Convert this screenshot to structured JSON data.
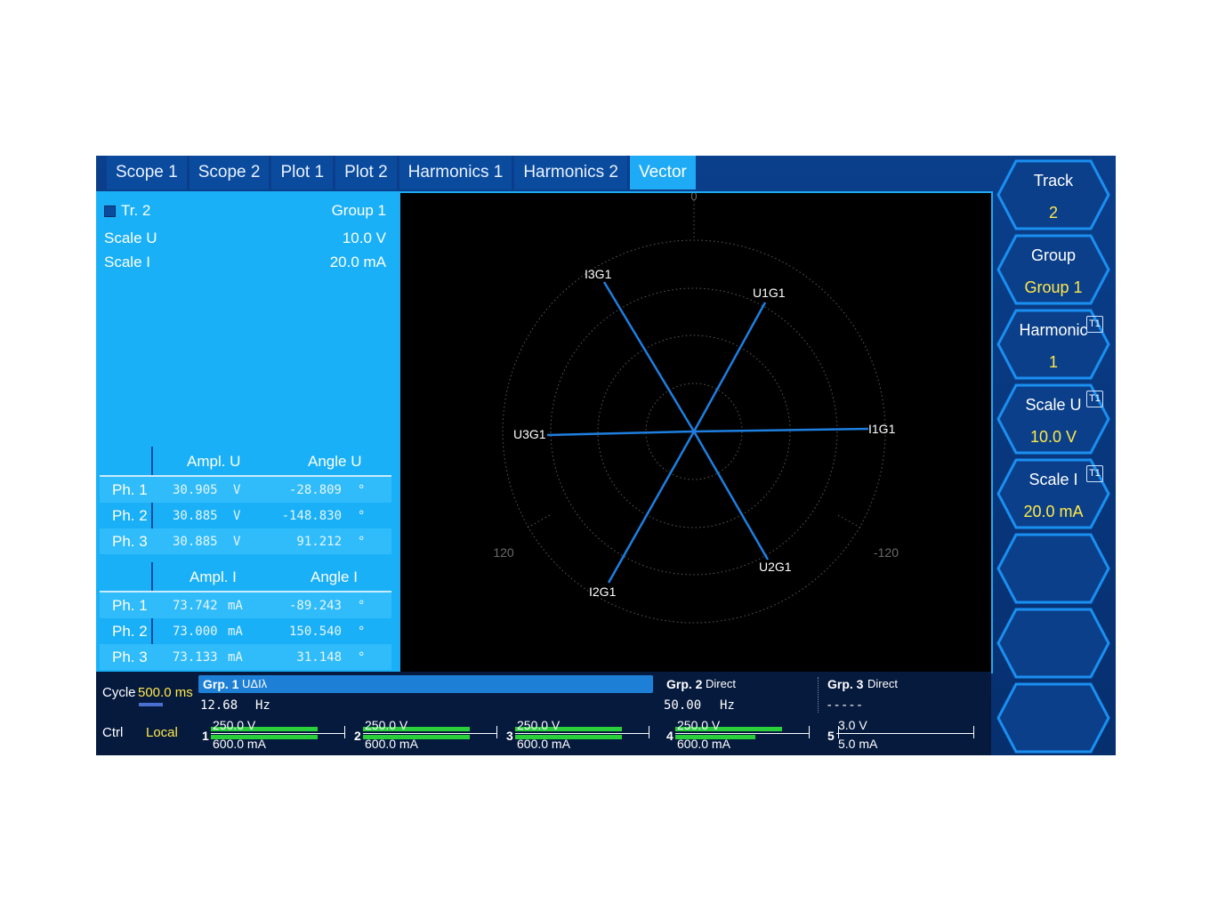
{
  "tabs": [
    "Scope 1",
    "Scope 2",
    "Plot 1",
    "Plot 2",
    "Harmonics 1",
    "Harmonics 2",
    "Vector"
  ],
  "active_tab": "Vector",
  "info": {
    "track": "Tr. 2",
    "group": "Group 1",
    "scale_u_label": "Scale U",
    "scale_u_value": "10.0 V",
    "scale_i_label": "Scale I",
    "scale_i_value": "20.0 mA"
  },
  "voltage_table": {
    "headers": [
      "Ampl. U",
      "Angle U"
    ],
    "rows": [
      {
        "phase": "Ph. 1",
        "ampl": "30.905",
        "unit": "V",
        "angle": "-28.809",
        "deg": "°"
      },
      {
        "phase": "Ph. 2",
        "ampl": "30.885",
        "unit": "V",
        "angle": "-148.830",
        "deg": "°"
      },
      {
        "phase": "Ph. 3",
        "ampl": "30.885",
        "unit": "V",
        "angle": "91.212",
        "deg": "°"
      }
    ]
  },
  "current_table": {
    "headers": [
      "Ampl. I",
      "Angle I"
    ],
    "rows": [
      {
        "phase": "Ph. 1",
        "ampl": "73.742",
        "unit": "mA",
        "angle": "-89.243",
        "deg": "°"
      },
      {
        "phase": "Ph. 2",
        "ampl": "73.000",
        "unit": "mA",
        "angle": "150.540",
        "deg": "°"
      },
      {
        "phase": "Ph. 3",
        "ampl": "73.133",
        "unit": "mA",
        "angle": "31.148",
        "deg": "°"
      }
    ]
  },
  "vector_plot": {
    "angle_labels": [
      "0",
      "120",
      "-120"
    ],
    "vectors": [
      "U1G1",
      "U2G1",
      "U3G1",
      "I1G1",
      "I2G1",
      "I3G1"
    ],
    "line_color": "#1e7fe0"
  },
  "softkeys": [
    {
      "label": "Track",
      "value": "2",
      "badge": ""
    },
    {
      "label": "Group",
      "value": "Group 1",
      "badge": ""
    },
    {
      "label": "Harmonic",
      "value": "1",
      "badge": "T1"
    },
    {
      "label": "Scale U",
      "value": "10.0 V",
      "badge": "T1"
    },
    {
      "label": "Scale I",
      "value": "20.0 mA",
      "badge": "T1"
    },
    {
      "label": "",
      "value": "",
      "badge": ""
    },
    {
      "label": "",
      "value": "",
      "badge": ""
    },
    {
      "label": "",
      "value": "",
      "badge": ""
    }
  ],
  "status": {
    "cycle_label": "Cycle",
    "cycle_value": "500.0 ms",
    "ctrl_label": "Ctrl",
    "ctrl_value": "Local",
    "groups": [
      {
        "name": "Grp. 1",
        "mode": "UΔIλ",
        "freq": "12.68",
        "freq_unit": "Hz"
      },
      {
        "name": "Grp. 2",
        "mode": "Direct",
        "freq": "50.00",
        "freq_unit": "Hz"
      },
      {
        "name": "Grp. 3",
        "mode": "Direct",
        "freq": "-----",
        "freq_unit": ""
      }
    ],
    "channels": [
      {
        "index": "1",
        "voltage": "250.0 V",
        "current": "600.0 mA",
        "u_level": 0.8,
        "i_level": 0.8
      },
      {
        "index": "2",
        "voltage": "250.0 V",
        "current": "600.0 mA",
        "u_level": 0.8,
        "i_level": 0.8
      },
      {
        "index": "3",
        "voltage": "250.0 V",
        "current": "600.0 mA",
        "u_level": 0.8,
        "i_level": 0.8
      },
      {
        "index": "4",
        "voltage": "250.0 V",
        "current": "600.0 mA",
        "u_level": 0.8,
        "i_level": 0.6
      },
      {
        "index": "5",
        "voltage": "3.0 V",
        "current": "5.0 mA",
        "u_level": 0,
        "i_level": 0
      }
    ]
  },
  "colors": {
    "panel": "#1ab0f7",
    "tab_active": "#1eaaf5",
    "accent_yellow": "#ffe94a",
    "level_green": "#2ad03a"
  }
}
